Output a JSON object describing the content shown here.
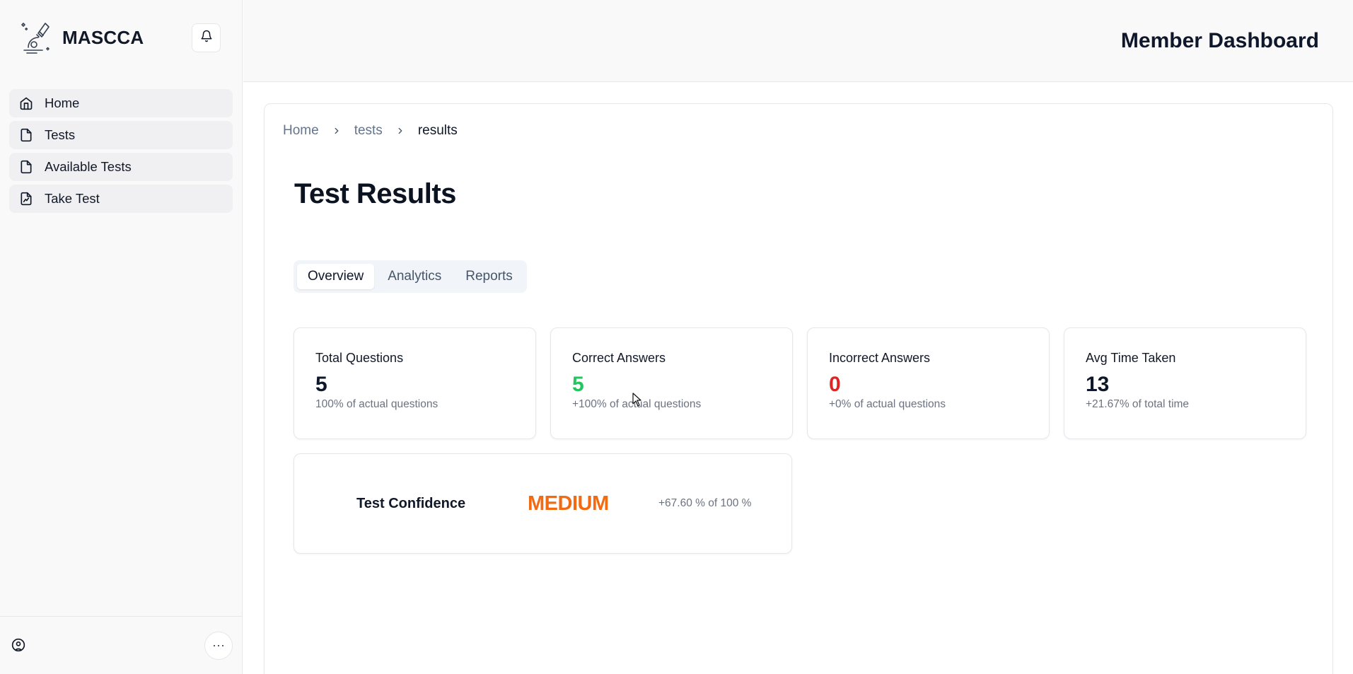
{
  "sidebar": {
    "brand_name": "MASCCA",
    "items": [
      {
        "label": "Home",
        "icon": "home-icon"
      },
      {
        "label": "Tests",
        "icon": "file-icon"
      },
      {
        "label": "Available Tests",
        "icon": "file-icon"
      },
      {
        "label": "Take Test",
        "icon": "file-chart-icon"
      }
    ],
    "footer": {
      "more_label": "···"
    }
  },
  "header": {
    "title": "Member Dashboard"
  },
  "breadcrumb": {
    "home": "Home",
    "tests": "tests",
    "current": "results"
  },
  "page": {
    "title": "Test Results"
  },
  "tabs": [
    {
      "label": "Overview",
      "active": true
    },
    {
      "label": "Analytics",
      "active": false
    },
    {
      "label": "Reports",
      "active": false
    }
  ],
  "stats": [
    {
      "label": "Total Questions",
      "value": "5",
      "sub": "100% of actual questions",
      "color": "#0f172a"
    },
    {
      "label": "Correct Answers",
      "value": "5",
      "sub": "+100% of actual questions",
      "color": "#22c55e"
    },
    {
      "label": "Incorrect Answers",
      "value": "0",
      "sub": "+0% of actual questions",
      "color": "#dc2626"
    },
    {
      "label": "Avg Time Taken",
      "value": "13",
      "sub": "+21.67% of total time",
      "color": "#0f172a"
    }
  ],
  "confidence": {
    "label": "Test Confidence",
    "value": "MEDIUM",
    "sub": "+67.60 % of 100 %",
    "color": "#f26b13"
  }
}
